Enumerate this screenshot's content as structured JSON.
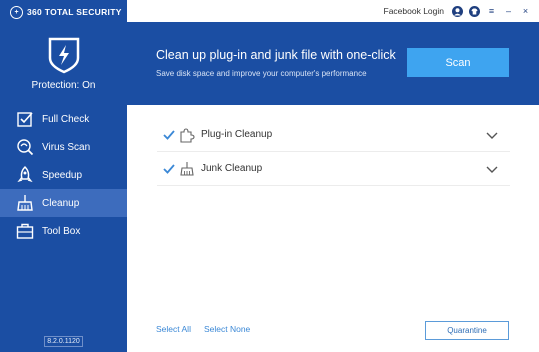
{
  "app": {
    "brand": "360 TOTAL SECURITY",
    "version": "8.2.0.1120"
  },
  "titlebar": {
    "login_label": "Facebook Login",
    "menu_glyph": "≡",
    "minimize_glyph": "–",
    "close_glyph": "×"
  },
  "sidebar": {
    "protection_label": "Protection: On",
    "items": [
      {
        "label": "Full Check",
        "icon": "check-box-icon",
        "active": false
      },
      {
        "label": "Virus Scan",
        "icon": "virus-scan-icon",
        "active": false
      },
      {
        "label": "Speedup",
        "icon": "rocket-icon",
        "active": false
      },
      {
        "label": "Cleanup",
        "icon": "broom-icon",
        "active": true
      },
      {
        "label": "Tool Box",
        "icon": "toolbox-icon",
        "active": false
      }
    ]
  },
  "banner": {
    "headline": "Clean up plug-in and junk file with one-click",
    "subtext": "Save disk space and improve your computer's performance",
    "scan_label": "Scan"
  },
  "list": {
    "rows": [
      {
        "label": "Plug-in Cleanup",
        "icon": "puzzle-icon",
        "checked": true
      },
      {
        "label": "Junk Cleanup",
        "icon": "broom-icon",
        "checked": true
      }
    ]
  },
  "footer": {
    "select_all": "Select All",
    "select_none": "Select None",
    "quarantine": "Quarantine"
  },
  "colors": {
    "sidebar": "#1b4ea3",
    "active_nav": "#3d6cbd",
    "scan_button": "#3ea4f0",
    "link": "#3b88d6"
  }
}
